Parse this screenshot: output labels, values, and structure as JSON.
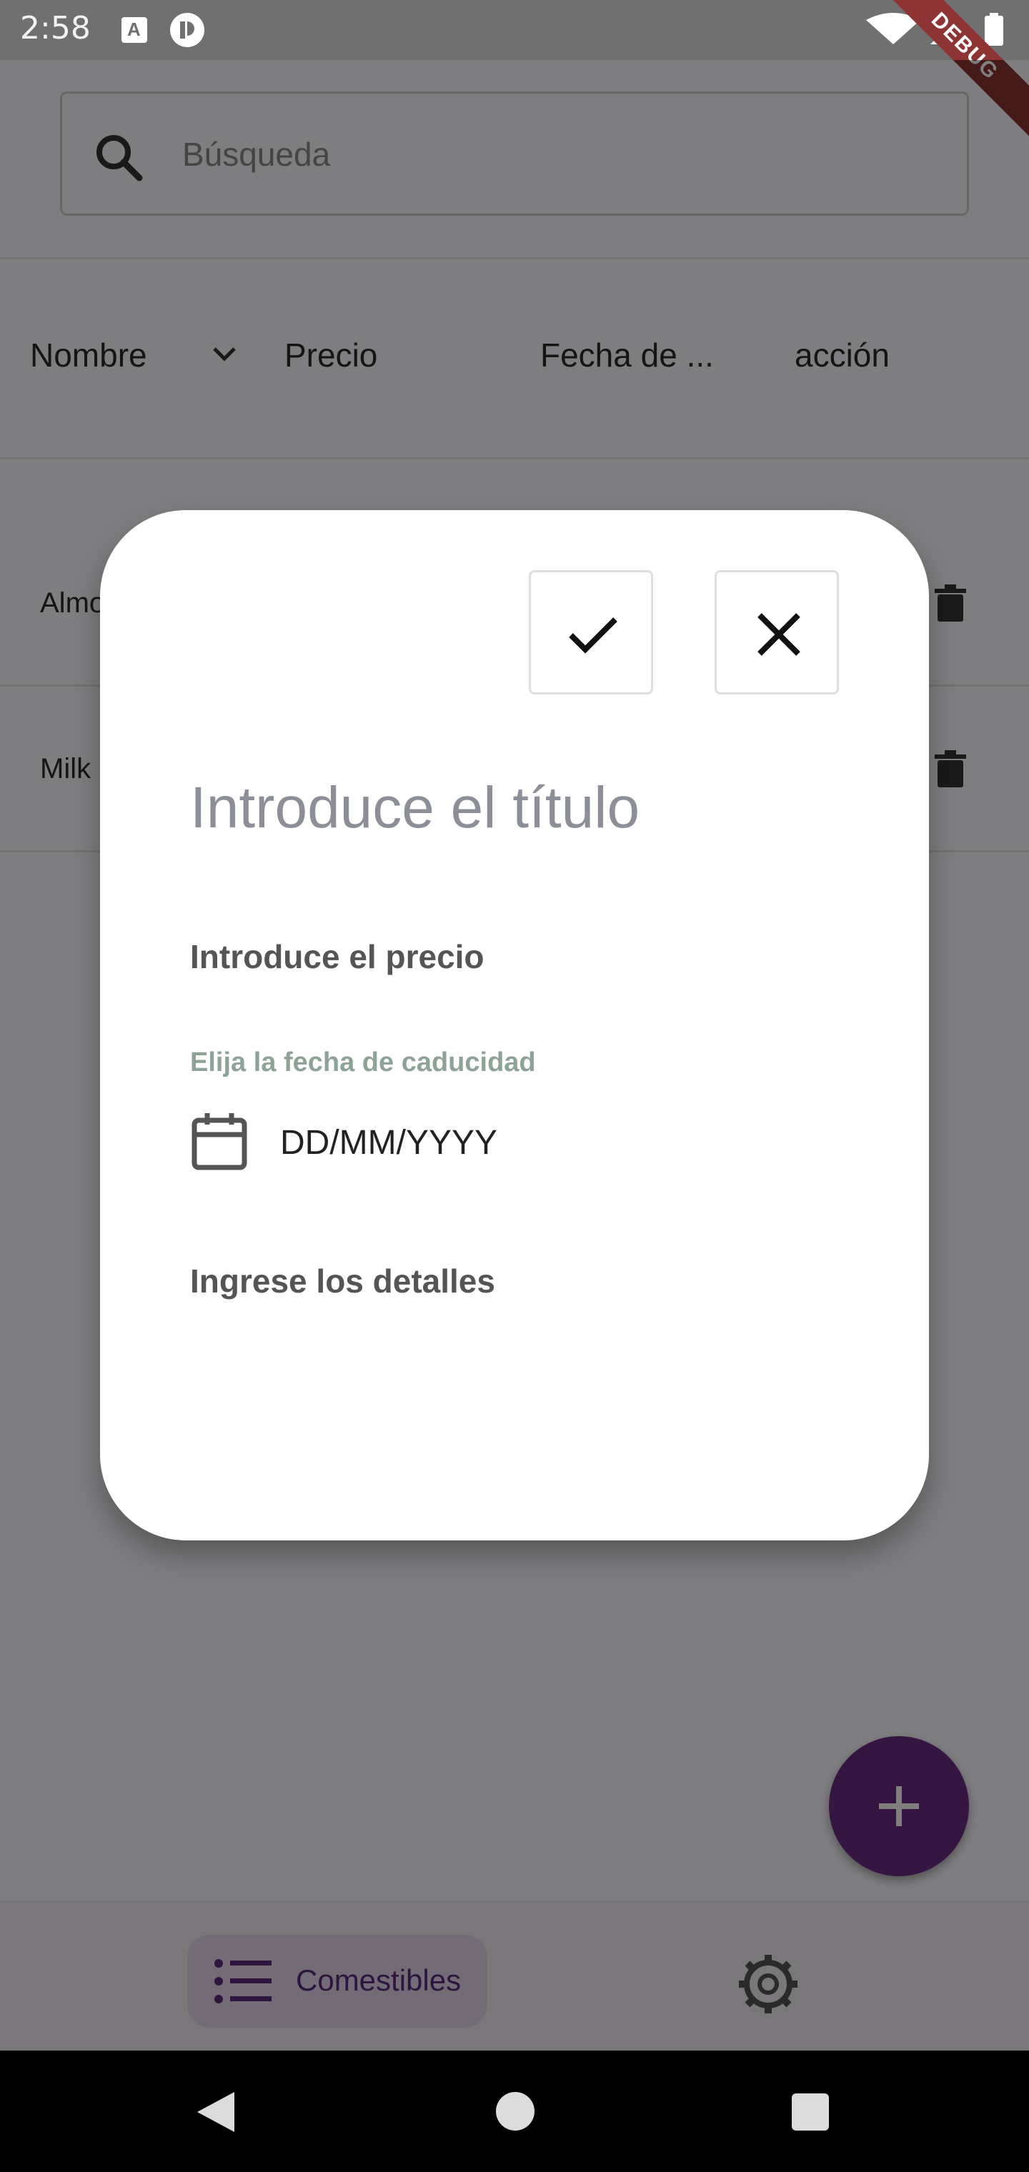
{
  "status_bar": {
    "time": "2:58",
    "a_icon_letter": "A",
    "debug_label": "DEBUG"
  },
  "search": {
    "placeholder": "Búsqueda"
  },
  "table": {
    "headers": [
      "Nombre",
      "Precio",
      "Fecha de ...",
      "acción"
    ],
    "rows": [
      {
        "name": "Almo"
      },
      {
        "name": "Milk"
      }
    ]
  },
  "dialog": {
    "title_placeholder": "Introduce el título",
    "price_placeholder": "Introduce el precio",
    "date_caption": "Elija la fecha de caducidad",
    "date_value": "DD/MM/YYYY",
    "details_placeholder": "Ingrese los detalles"
  },
  "bottom_nav": {
    "items": [
      {
        "label": "Comestibles",
        "icon": "list-icon",
        "selected": true
      },
      {
        "label": "",
        "icon": "gear-icon",
        "selected": false
      }
    ]
  },
  "fab": {
    "icon": "plus-icon"
  },
  "colors": {
    "accent": "#6b2a85",
    "nav_pill": "#e6d9ee",
    "debug": "#8f3434"
  }
}
